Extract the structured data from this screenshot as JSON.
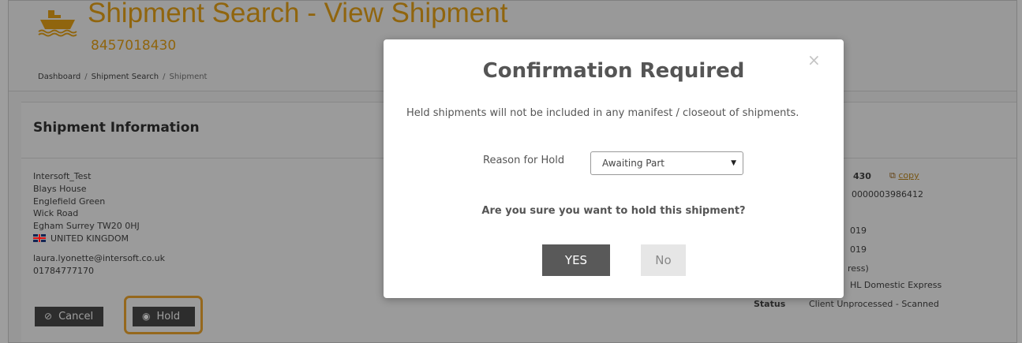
{
  "header": {
    "title": "Shipment Search - View Shipment",
    "shipment_id": "8457018430",
    "breadcrumb": [
      "Dashboard",
      "Shipment Search",
      "Shipment"
    ],
    "icon": "ship-icon",
    "accent_color": "#e8a317"
  },
  "panel": {
    "title": "Shipment Information",
    "address_lines": [
      "Intersoft_Test",
      "Blays House",
      "Englefield Green",
      "Wick Road",
      "Egham Surrey TW20 0HJ"
    ],
    "country": "UNITED KINGDOM",
    "email": "laura.lyonette@intersoft.co.uk",
    "phone": "01784777170",
    "cancel_label": "Cancel",
    "hold_label": "Hold",
    "right_fragments": {
      "awb_tail": "430",
      "copy_label": "copy",
      "ref_tail": "0000003986412",
      "date1_tail": "019",
      "date2_tail": "019",
      "service_tail": "ress)",
      "product_tail": "HL Domestic Express",
      "status_label": "Status",
      "status_value": "Client Unprocessed - Scanned"
    }
  },
  "modal": {
    "title": "Confirmation Required",
    "message": "Held shipments will not be included in any manifest / closeout of shipments.",
    "reason_label": "Reason for Hold",
    "reason_selected": "Awaiting Part",
    "question": "Are you sure you want to hold this shipment?",
    "yes_label": "YES",
    "no_label": "No",
    "close_glyph": "×"
  }
}
